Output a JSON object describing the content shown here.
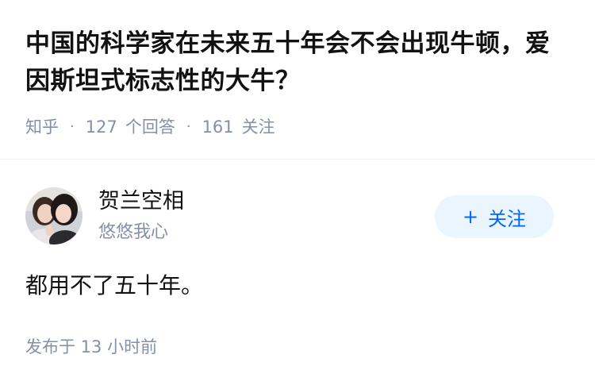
{
  "question": {
    "title": "中国的科学家在未来五十年会不会出现牛顿，爱因斯坦式标志性的大牛？",
    "source": "知乎",
    "separator": "·",
    "answers_count": "127",
    "answers_label": "个回答",
    "followers_count": "161",
    "followers_label": "关注"
  },
  "author": {
    "name": "贺兰空相",
    "bio": "悠悠我心",
    "follow_plus": "+",
    "follow_label": "关注"
  },
  "answer": {
    "content": "都用不了五十年。",
    "published": "发布于  13 小时前"
  },
  "colors": {
    "accent": "#0066ff",
    "follow_bg": "#ebf5fd",
    "muted_text": "#8590a6",
    "text": "#121212"
  },
  "icons": {
    "avatar": "avatar-photo"
  }
}
